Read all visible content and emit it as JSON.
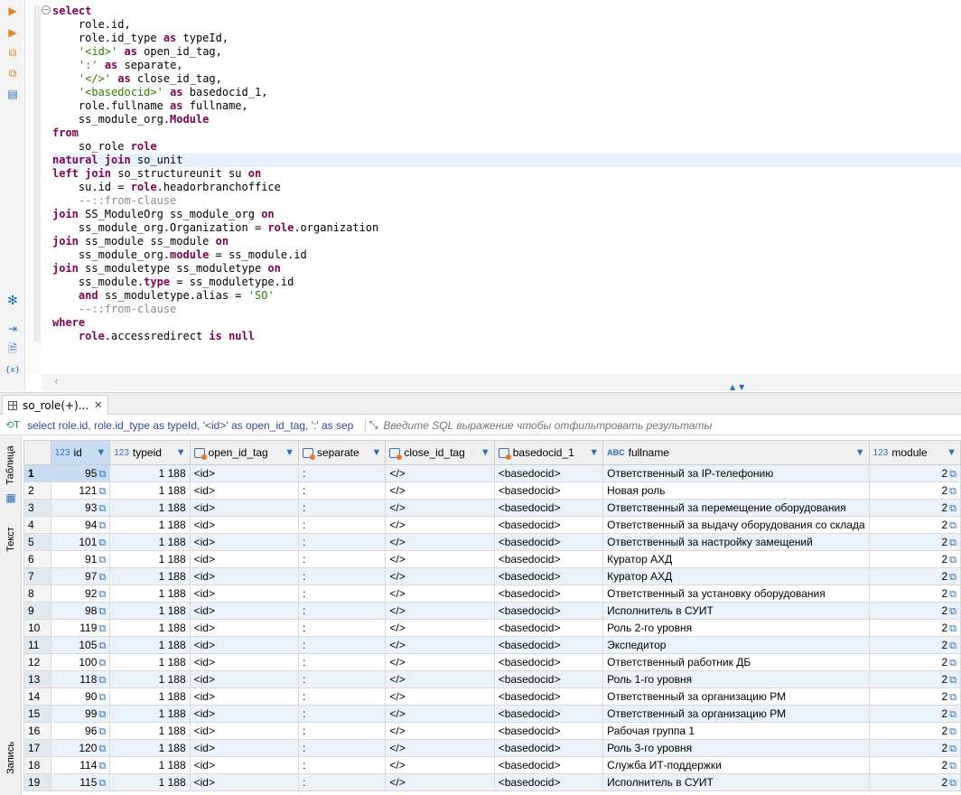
{
  "editor": {
    "lines": [
      [
        {
          "t": "select",
          "c": "kw"
        }
      ],
      [
        {
          "t": "    role.id,"
        }
      ],
      [
        {
          "t": "    role.id_type "
        },
        {
          "t": "as",
          "c": "kw"
        },
        {
          "t": " typeId,"
        }
      ],
      [
        {
          "t": "    "
        },
        {
          "t": "'<id>'",
          "c": "str"
        },
        {
          "t": " "
        },
        {
          "t": "as",
          "c": "kw"
        },
        {
          "t": " open_id_tag,"
        }
      ],
      [
        {
          "t": "    "
        },
        {
          "t": "':'",
          "c": "str"
        },
        {
          "t": " "
        },
        {
          "t": "as",
          "c": "kw"
        },
        {
          "t": " separate,"
        }
      ],
      [
        {
          "t": "    "
        },
        {
          "t": "'</>'",
          "c": "str"
        },
        {
          "t": " "
        },
        {
          "t": "as",
          "c": "kw"
        },
        {
          "t": " close_id_tag,"
        }
      ],
      [
        {
          "t": "    "
        },
        {
          "t": "'<basedocid>'",
          "c": "str"
        },
        {
          "t": " "
        },
        {
          "t": "as",
          "c": "kw"
        },
        {
          "t": " basedocid_1,"
        }
      ],
      [
        {
          "t": "    role.fullname "
        },
        {
          "t": "as",
          "c": "kw"
        },
        {
          "t": " fullname,"
        }
      ],
      [
        {
          "t": "    ss_module_org."
        },
        {
          "t": "Module",
          "c": "kw"
        }
      ],
      [
        {
          "t": "from",
          "c": "kw"
        }
      ],
      [
        {
          "t": "    so_role "
        },
        {
          "t": "role",
          "c": "kw"
        }
      ],
      [
        {
          "t": "natural join",
          "c": "kw"
        },
        {
          "t": " so_unit"
        }
      ],
      [
        {
          "t": "left join",
          "c": "kw"
        },
        {
          "t": " so_structureunit su "
        },
        {
          "t": "on",
          "c": "kw"
        }
      ],
      [
        {
          "t": "    su.id = "
        },
        {
          "t": "role",
          "c": "kw"
        },
        {
          "t": ".headorbranchoffice"
        }
      ],
      [
        {
          "t": "    --::from-clause",
          "c": "cm"
        }
      ],
      [
        {
          "t": "join",
          "c": "kw"
        },
        {
          "t": " SS_ModuleOrg ss_module_org "
        },
        {
          "t": "on",
          "c": "kw"
        }
      ],
      [
        {
          "t": "    ss_module_org.Organization = "
        },
        {
          "t": "role",
          "c": "kw"
        },
        {
          "t": ".organization"
        }
      ],
      [
        {
          "t": "join",
          "c": "kw"
        },
        {
          "t": " ss_module ss_module "
        },
        {
          "t": "on",
          "c": "kw"
        }
      ],
      [
        {
          "t": "    ss_module_org."
        },
        {
          "t": "module",
          "c": "kw"
        },
        {
          "t": " = ss_module.id"
        }
      ],
      [
        {
          "t": "join",
          "c": "kw"
        },
        {
          "t": " ss_moduletype ss_moduletype "
        },
        {
          "t": "on",
          "c": "kw"
        }
      ],
      [
        {
          "t": "    ss_module."
        },
        {
          "t": "type",
          "c": "kw"
        },
        {
          "t": " = ss_moduletype.id"
        }
      ],
      [
        {
          "t": "    "
        },
        {
          "t": "and",
          "c": "kw"
        },
        {
          "t": " ss_moduletype.alias = "
        },
        {
          "t": "'SO'",
          "c": "str"
        }
      ],
      [
        {
          "t": "    --::from-clause",
          "c": "cm"
        }
      ],
      [
        {
          "t": "where",
          "c": "kw"
        }
      ],
      [
        {
          "t": "    role",
          "c": "kw"
        },
        {
          "t": ".accessredirect "
        },
        {
          "t": "is null",
          "c": "kw"
        }
      ]
    ],
    "highlighted_line": 11
  },
  "results": {
    "tab_label": "so_role(+)...",
    "tab_close": "✕",
    "filter_sql": "select role.id, role.id_type as typeId, '<id>' as open_id_tag, ':' as sep",
    "filter_placeholder": "Введите SQL выражение чтобы отфильтровать результаты",
    "side_tabs": {
      "table": "Таблица",
      "text": "Текст",
      "record": "Запись"
    },
    "columns": [
      {
        "label": "id",
        "type": "123"
      },
      {
        "label": "typeid",
        "type": "123"
      },
      {
        "label": "open_id_tag",
        "type": "box"
      },
      {
        "label": "separate",
        "type": "box"
      },
      {
        "label": "close_id_tag",
        "type": "box"
      },
      {
        "label": "basedocid_1",
        "type": "box"
      },
      {
        "label": "fullname",
        "type": "ABC"
      },
      {
        "label": "module",
        "type": "123"
      }
    ],
    "rows": [
      [
        "1",
        "95",
        "1 188",
        "<id>",
        ":",
        "</>",
        "<basedocid>",
        "Ответственный за IP-телефонию",
        "2"
      ],
      [
        "2",
        "121",
        "1 188",
        "<id>",
        ":",
        "</>",
        "<basedocid>",
        "Новая роль",
        "2"
      ],
      [
        "3",
        "93",
        "1 188",
        "<id>",
        ":",
        "</>",
        "<basedocid>",
        "Ответственный за перемещение оборудования",
        "2"
      ],
      [
        "4",
        "94",
        "1 188",
        "<id>",
        ":",
        "</>",
        "<basedocid>",
        "Ответственный за выдачу оборудования со склада",
        "2"
      ],
      [
        "5",
        "101",
        "1 188",
        "<id>",
        ":",
        "</>",
        "<basedocid>",
        "Ответственный за настройку замещений",
        "2"
      ],
      [
        "6",
        "91",
        "1 188",
        "<id>",
        ":",
        "</>",
        "<basedocid>",
        "Куратор АХД",
        "2"
      ],
      [
        "7",
        "97",
        "1 188",
        "<id>",
        ":",
        "</>",
        "<basedocid>",
        "Куратор АХД",
        "2"
      ],
      [
        "8",
        "92",
        "1 188",
        "<id>",
        ":",
        "</>",
        "<basedocid>",
        "Ответственный за установку оборудования",
        "2"
      ],
      [
        "9",
        "98",
        "1 188",
        "<id>",
        ":",
        "</>",
        "<basedocid>",
        "Исполнитель в СУИТ",
        "2"
      ],
      [
        "10",
        "119",
        "1 188",
        "<id>",
        ":",
        "</>",
        "<basedocid>",
        "Роль 2-го уровня",
        "2"
      ],
      [
        "11",
        "105",
        "1 188",
        "<id>",
        ":",
        "</>",
        "<basedocid>",
        "Экспедитор",
        "2"
      ],
      [
        "12",
        "100",
        "1 188",
        "<id>",
        ":",
        "</>",
        "<basedocid>",
        "Ответственный работник ДБ",
        "2"
      ],
      [
        "13",
        "118",
        "1 188",
        "<id>",
        ":",
        "</>",
        "<basedocid>",
        "Роль 1-го уровня",
        "2"
      ],
      [
        "14",
        "90",
        "1 188",
        "<id>",
        ":",
        "</>",
        "<basedocid>",
        "Ответственный за организацию РМ",
        "2"
      ],
      [
        "15",
        "99",
        "1 188",
        "<id>",
        ":",
        "</>",
        "<basedocid>",
        "Ответственный за организацию РМ",
        "2"
      ],
      [
        "16",
        "96",
        "1 188",
        "<id>",
        ":",
        "</>",
        "<basedocid>",
        "Рабочая группа 1",
        "2"
      ],
      [
        "17",
        "120",
        "1 188",
        "<id>",
        ":",
        "</>",
        "<basedocid>",
        "Роль 3-го уровня",
        "2"
      ],
      [
        "18",
        "114",
        "1 188",
        "<id>",
        ":",
        "</>",
        "<basedocid>",
        "Служба ИТ-поддержки",
        "2"
      ],
      [
        "19",
        "115",
        "1 188",
        "<id>",
        ":",
        "</>",
        "<basedocid>",
        "Исполнитель в СУИТ",
        "2"
      ]
    ],
    "selected_row": 1
  },
  "icons": [
    "execute-icon",
    "execute-new-tab-icon",
    "execute-script-icon",
    "execute-script-new-tab-icon",
    "explain-plan-icon",
    "settings-icon",
    "export-icon",
    "save-icon",
    "format-icon",
    "filter-icon",
    "link-icon"
  ],
  "colors": {
    "keyword": "#7f0055",
    "string": "#2a8000",
    "comment": "#8a8a8a",
    "accent": "#2a6fba",
    "selection": "#c8dcf2"
  }
}
